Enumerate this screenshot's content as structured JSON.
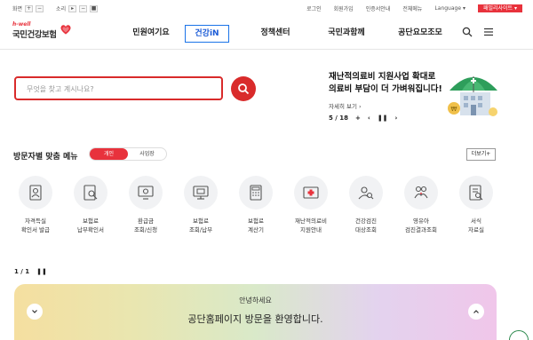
{
  "util": {
    "zoom_label": "화면",
    "zoom_in": "+",
    "zoom_out": "−",
    "sound_label": "소리",
    "sound_play": "▸",
    "sound_stop": "■",
    "links": [
      "로그인",
      "회원가입",
      "인증서안내",
      "전체메뉴"
    ],
    "language": "Language ▾",
    "family_site": "패밀리사이트 ▾"
  },
  "header": {
    "logo_tag": "h-well",
    "logo_name": "국민건강보험",
    "nav": [
      "민원여기요",
      "건강iN",
      "정책센터",
      "국민과함께",
      "공단요모조모"
    ],
    "active_nav": "건강iN"
  },
  "search": {
    "placeholder": "무엇을 찾고 계시나요?"
  },
  "banner": {
    "title_line1": "재난적의료비 지원사업 확대로",
    "title_line2": "의료비 부담이 더 가벼워집니다!",
    "more": "자세히 보기 ›",
    "page": "5 / 18",
    "plus": "+",
    "prev": "‹",
    "pause": "❚❚",
    "next": "›"
  },
  "visitor_menu": {
    "title": "방문자별 맞춤 메뉴",
    "toggle": [
      "개인",
      "사업장"
    ],
    "selected": "개인",
    "more": "더보기+",
    "items": [
      {
        "line1": "자격득실",
        "line2": "확인서 발급",
        "icon": "certificate-icon"
      },
      {
        "line1": "보험료",
        "line2": "납부확인서",
        "icon": "document-search-icon"
      },
      {
        "line1": "환급금",
        "line2": "조회/신청",
        "icon": "monitor-refund-icon"
      },
      {
        "line1": "보험료",
        "line2": "조회/납부",
        "icon": "payment-monitor-icon"
      },
      {
        "line1": "보험료",
        "line2": "계산기",
        "icon": "calculator-icon"
      },
      {
        "line1": "재난적의료비",
        "line2": "지원안내",
        "icon": "medical-card-icon"
      },
      {
        "line1": "건강검진",
        "line2": "대상조회",
        "icon": "person-search-icon"
      },
      {
        "line1": "영유아",
        "line2": "검진결과조회",
        "icon": "family-icon"
      },
      {
        "line1": "서식",
        "line2": "자료실",
        "icon": "form-search-icon"
      }
    ]
  },
  "pager2": {
    "page": "1 / 1",
    "pause": "❚❚"
  },
  "welcome": {
    "hello": "안녕하세요",
    "message": "공단홈페이지 방문을 환영합니다."
  },
  "colors": {
    "brand": "#e8323c",
    "active_nav": "#1a73e8",
    "search_border": "#d92b2b"
  }
}
